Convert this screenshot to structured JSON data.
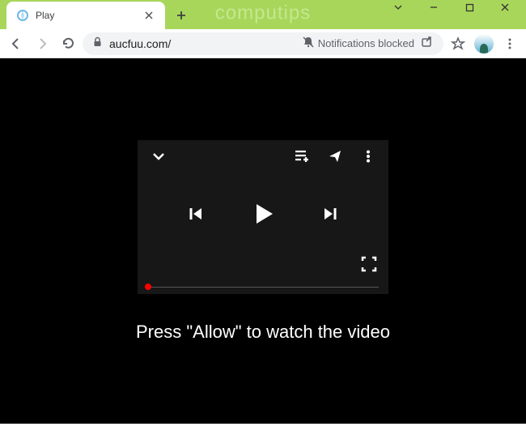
{
  "watermark": "computips",
  "tab": {
    "title": "Play"
  },
  "address": {
    "url": "aucfuu.com/",
    "notification_text": "Notifications blocked"
  },
  "page": {
    "message": "Press \"Allow\" to watch the video"
  }
}
